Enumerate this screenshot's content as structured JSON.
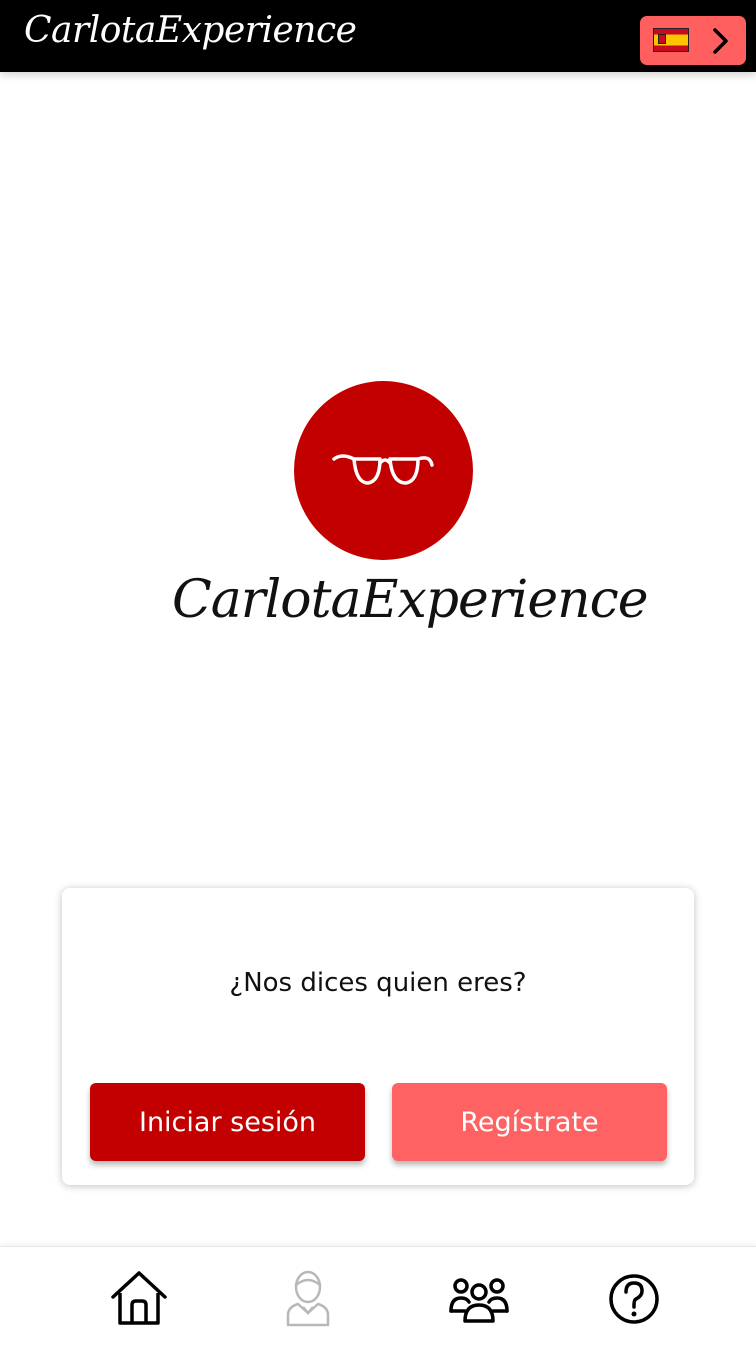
{
  "header": {
    "title": "CarlotaExperience",
    "language_icon": "spain-flag-icon",
    "language_arrow_icon": "chevron-right-icon"
  },
  "logo": {
    "text": "CarlotaExperience",
    "icon": "glasses-icon"
  },
  "card": {
    "question": "¿Nos dices quien eres?",
    "login_label": "Iniciar sesión",
    "register_label": "Regístrate"
  },
  "bottom_nav": {
    "items": [
      {
        "icon": "home-icon",
        "active": true
      },
      {
        "icon": "user-icon",
        "active": false
      },
      {
        "icon": "group-icon",
        "active": true
      },
      {
        "icon": "help-icon",
        "active": true
      }
    ]
  },
  "colors": {
    "primary": "#c20000",
    "secondary": "#ff6262",
    "header_bg": "#000000"
  }
}
